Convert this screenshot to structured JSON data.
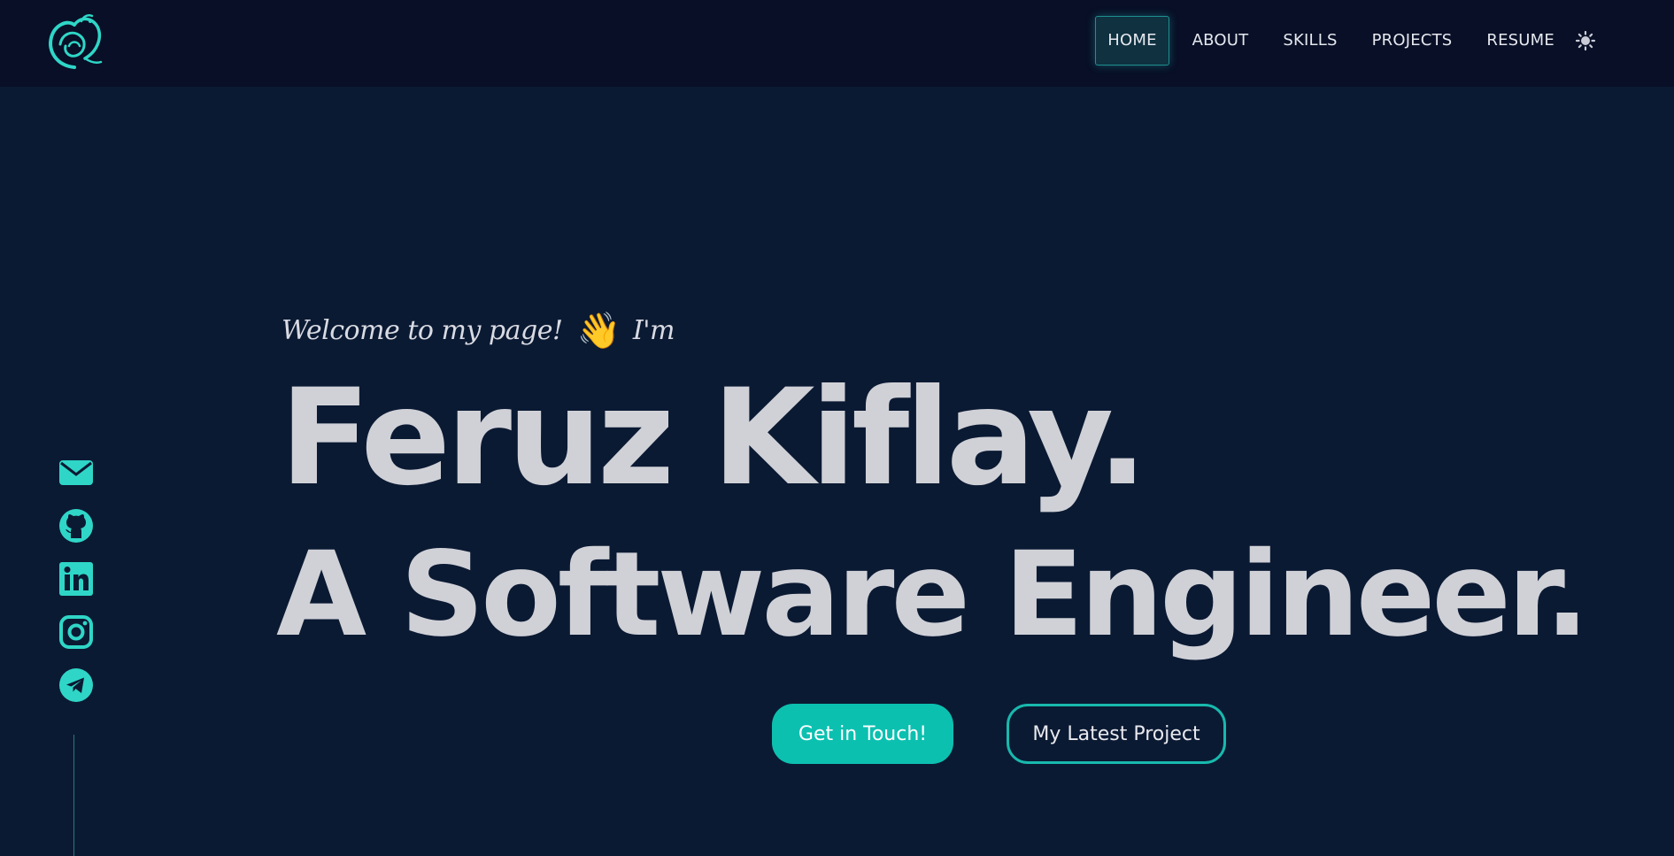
{
  "header": {
    "logo_icon": "phoenix-logo-icon",
    "nav": [
      {
        "label": "HOME",
        "active": true
      },
      {
        "label": "ABOUT",
        "active": false
      },
      {
        "label": "SKILLS",
        "active": false
      },
      {
        "label": "PROJECTS",
        "active": false
      },
      {
        "label": "RESUME",
        "active": false
      }
    ],
    "theme_icon": "sun-icon"
  },
  "hero": {
    "greeting": "Welcome to my page!",
    "wave_emoji": "👋",
    "greeting_suffix": "I'm",
    "name": "Feruz Kiflay.",
    "role": "A Software Engineer.",
    "primary_button": "Get in Touch!",
    "secondary_button": "My Latest Project"
  },
  "social": {
    "icons": [
      "email-icon",
      "github-icon",
      "linkedin-icon",
      "instagram-icon",
      "telegram-icon"
    ]
  },
  "colors": {
    "background": "#0b1a33",
    "navbar": "#080f26",
    "accent": "#0cc0b0",
    "icon": "#2fd6c7",
    "text": "#d0d1d7"
  }
}
